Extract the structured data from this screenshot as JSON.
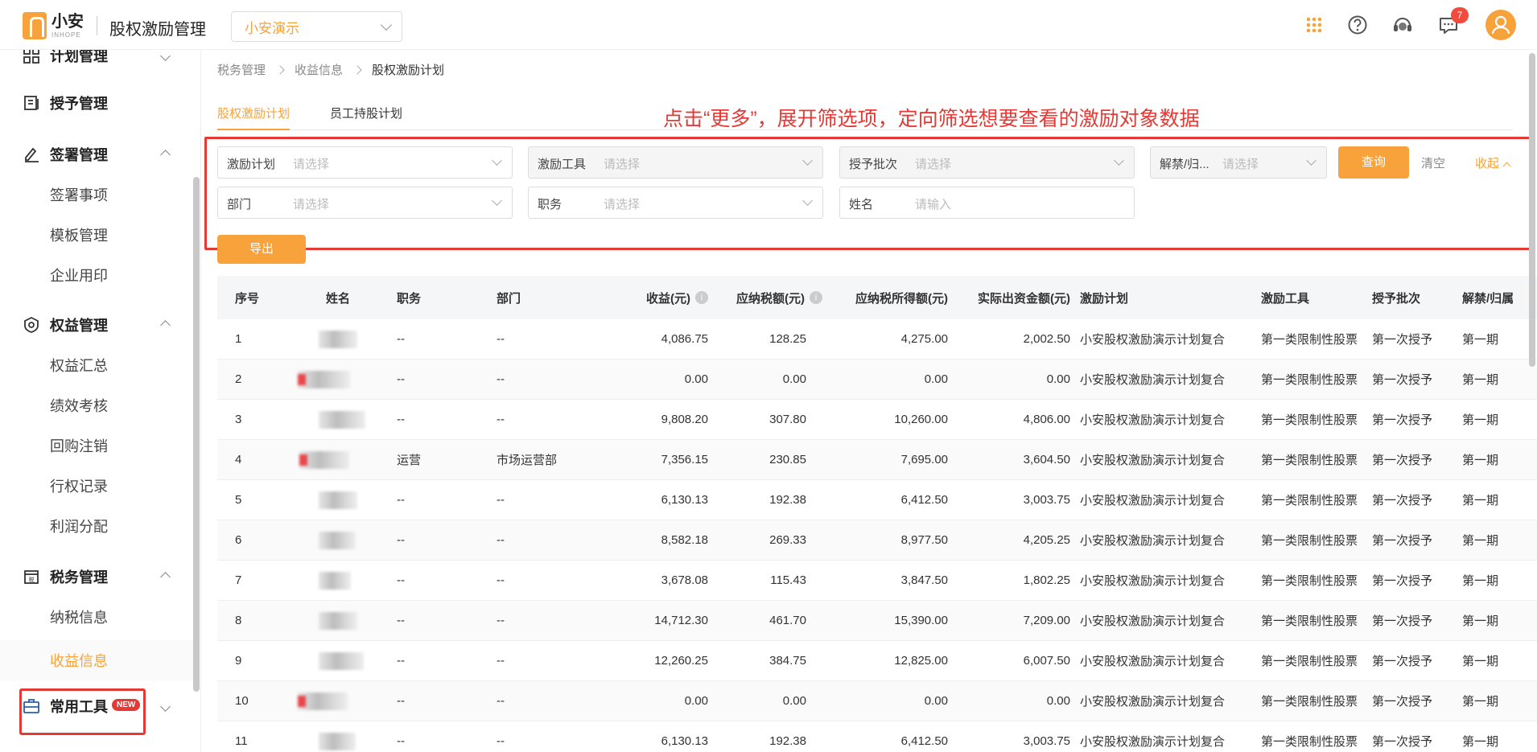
{
  "header": {
    "logo_cn": "小安",
    "logo_en": "INHOPE",
    "app_title": "股权激励管理",
    "company": "小安演示",
    "message_count": "7"
  },
  "sidebar": {
    "groups": [
      {
        "label": "计划管理",
        "icon": "plan-icon",
        "expanded": false
      },
      {
        "label": "授予管理",
        "icon": "grant-icon"
      },
      {
        "label": "签署管理",
        "icon": "sign-icon",
        "expanded": true
      },
      {
        "label": "权益管理",
        "icon": "equity-icon",
        "expanded": true
      },
      {
        "label": "税务管理",
        "icon": "tax-icon",
        "expanded": true
      },
      {
        "label": "常用工具",
        "icon": "toolbox-icon",
        "badge": "NEW",
        "expanded": false
      }
    ],
    "items": {
      "sign": [
        "签署事项",
        "模板管理",
        "企业用印"
      ],
      "equity": [
        "权益汇总",
        "绩效考核",
        "回购注销",
        "行权记录",
        "利润分配"
      ],
      "tax": [
        "纳税信息",
        "收益信息"
      ]
    }
  },
  "breadcrumb": [
    "税务管理",
    "收益信息",
    "股权激励计划"
  ],
  "tabs": [
    {
      "label": "股权激励计划",
      "active": true
    },
    {
      "label": "员工持股计划",
      "active": false
    }
  ],
  "tip": "点击“更多”，展开筛选项，定向筛选想要查看的激励对象数据",
  "filters": {
    "plan": {
      "label": "激励计划",
      "placeholder": "请选择"
    },
    "tool": {
      "label": "激励工具",
      "placeholder": "请选择"
    },
    "batch": {
      "label": "授予批次",
      "placeholder": "请选择"
    },
    "unlock": {
      "label": "解禁/归...",
      "placeholder": "请选择"
    },
    "dept": {
      "label": "部门",
      "placeholder": "请选择"
    },
    "position": {
      "label": "职务",
      "placeholder": "请选择"
    },
    "name": {
      "label": "姓名",
      "placeholder": "请输入"
    },
    "query": "查询",
    "clear": "清空",
    "collapse": "收起"
  },
  "export": "导出",
  "table": {
    "columns": [
      "序号",
      "姓名",
      "职务",
      "部门",
      "收益(元)",
      "应纳税额(元)",
      "应纳税所得额(元)",
      "实际出资金额(元)",
      "激励计划",
      "激励工具",
      "授予批次",
      "解禁/归属"
    ],
    "rows": [
      {
        "no": "1",
        "position": "--",
        "dept": "--",
        "income": "4,086.75",
        "tax": "128.25",
        "taxable": "4,275.00",
        "paid": "2,002.50",
        "plan": "小安股权激励演示计划复合",
        "tool": "第一类限制性股票",
        "batch": "第一次授予",
        "unlock": "第一期"
      },
      {
        "no": "2",
        "position": "--",
        "dept": "--",
        "income": "0.00",
        "tax": "0.00",
        "taxable": "0.00",
        "paid": "0.00",
        "plan": "小安股权激励演示计划复合",
        "tool": "第一类限制性股票",
        "batch": "第一次授予",
        "unlock": "第一期"
      },
      {
        "no": "3",
        "position": "--",
        "dept": "--",
        "income": "9,808.20",
        "tax": "307.80",
        "taxable": "10,260.00",
        "paid": "4,806.00",
        "plan": "小安股权激励演示计划复合",
        "tool": "第一类限制性股票",
        "batch": "第一次授予",
        "unlock": "第一期"
      },
      {
        "no": "4",
        "position": "运营",
        "dept": "市场运营部",
        "income": "7,356.15",
        "tax": "230.85",
        "taxable": "7,695.00",
        "paid": "3,604.50",
        "plan": "小安股权激励演示计划复合",
        "tool": "第一类限制性股票",
        "batch": "第一次授予",
        "unlock": "第一期"
      },
      {
        "no": "5",
        "position": "--",
        "dept": "--",
        "income": "6,130.13",
        "tax": "192.38",
        "taxable": "6,412.50",
        "paid": "3,003.75",
        "plan": "小安股权激励演示计划复合",
        "tool": "第一类限制性股票",
        "batch": "第一次授予",
        "unlock": "第一期"
      },
      {
        "no": "6",
        "position": "--",
        "dept": "--",
        "income": "8,582.18",
        "tax": "269.33",
        "taxable": "8,977.50",
        "paid": "4,205.25",
        "plan": "小安股权激励演示计划复合",
        "tool": "第一类限制性股票",
        "batch": "第一次授予",
        "unlock": "第一期"
      },
      {
        "no": "7",
        "position": "--",
        "dept": "--",
        "income": "3,678.08",
        "tax": "115.43",
        "taxable": "3,847.50",
        "paid": "1,802.25",
        "plan": "小安股权激励演示计划复合",
        "tool": "第一类限制性股票",
        "batch": "第一次授予",
        "unlock": "第一期"
      },
      {
        "no": "8",
        "position": "--",
        "dept": "--",
        "income": "14,712.30",
        "tax": "461.70",
        "taxable": "15,390.00",
        "paid": "7,209.00",
        "plan": "小安股权激励演示计划复合",
        "tool": "第一类限制性股票",
        "batch": "第一次授予",
        "unlock": "第一期"
      },
      {
        "no": "9",
        "position": "--",
        "dept": "--",
        "income": "12,260.25",
        "tax": "384.75",
        "taxable": "12,825.00",
        "paid": "6,007.50",
        "plan": "小安股权激励演示计划复合",
        "tool": "第一类限制性股票",
        "batch": "第一次授予",
        "unlock": "第一期"
      },
      {
        "no": "10",
        "position": "--",
        "dept": "--",
        "income": "0.00",
        "tax": "0.00",
        "taxable": "0.00",
        "paid": "0.00",
        "plan": "小安股权激励演示计划复合",
        "tool": "第一类限制性股票",
        "batch": "第一次授予",
        "unlock": "第一期"
      },
      {
        "no": "11",
        "position": "--",
        "dept": "--",
        "income": "6,130.13",
        "tax": "192.38",
        "taxable": "6,412.50",
        "paid": "3,003.75",
        "plan": "小安股权激励演示计划复合",
        "tool": "第一类限制性股票",
        "batch": "第一次授予",
        "unlock": "第一期"
      }
    ]
  },
  "colors": {
    "accent": "#f7a23b",
    "highlight": "#e53935",
    "badge": "#f04b3c"
  }
}
